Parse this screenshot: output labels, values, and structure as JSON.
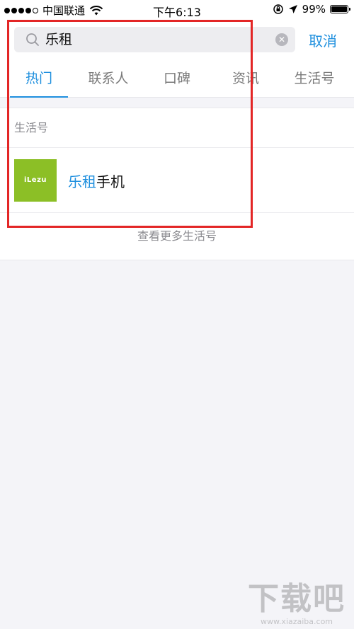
{
  "status_bar": {
    "carrier": "中国联通",
    "time": "下午6:13",
    "battery": "99%",
    "battery_level": 0.99
  },
  "search": {
    "query": "乐租",
    "cancel_label": "取消"
  },
  "tabs": [
    {
      "label": "热门",
      "active": true
    },
    {
      "label": "联系人",
      "active": false
    },
    {
      "label": "口碑",
      "active": false
    },
    {
      "label": "资讯",
      "active": false
    },
    {
      "label": "生活号",
      "active": false
    }
  ],
  "results": {
    "section_title": "生活号",
    "items": [
      {
        "logo_text": "iLezu",
        "name_highlight": "乐租",
        "name_rest": "手机"
      }
    ],
    "more_label": "查看更多生活号"
  },
  "colors": {
    "accent": "#1e8fde",
    "logo_bg": "#8cbf26",
    "annotation": "#e32626"
  },
  "watermark": {
    "logo": "下载吧",
    "url": "www.xiazaiba.com"
  }
}
